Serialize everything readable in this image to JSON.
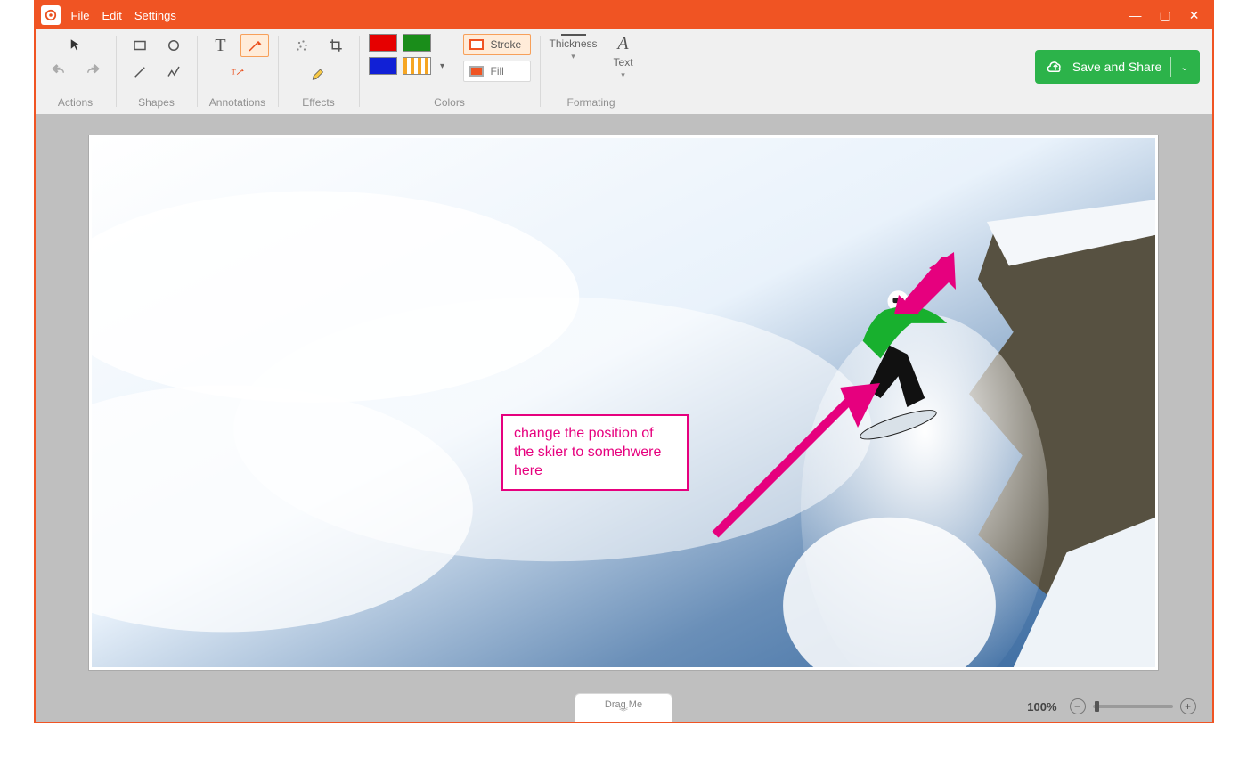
{
  "menu": {
    "file": "File",
    "edit": "Edit",
    "settings": "Settings"
  },
  "ribbon": {
    "groups": {
      "actions": "Actions",
      "shapes": "Shapes",
      "annotations": "Annotations",
      "effects": "Effects",
      "colors": "Colors",
      "formatting": "Formating"
    },
    "stroke_label": "Stroke",
    "fill_label": "Fill",
    "thickness_label": "Thickness",
    "text_label": "Text"
  },
  "save_button": "Save and Share",
  "annotation_text": "change the position of the skier to somehwere here",
  "status": {
    "zoom": "100%",
    "drag_me": "Drag Me"
  },
  "colors": {
    "accent": "#ea4e1b",
    "annotation": "#e6007e",
    "save": "#2cb34a"
  }
}
